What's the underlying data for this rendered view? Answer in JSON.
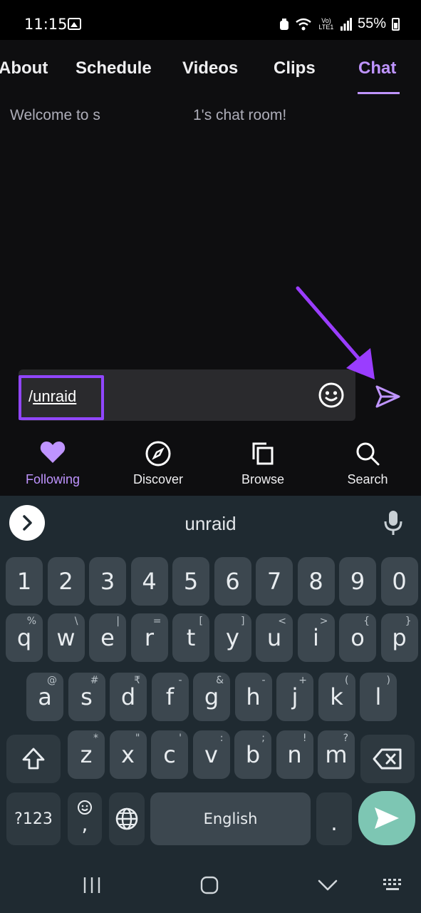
{
  "status_bar": {
    "time": "11:15",
    "network": "Vo) LTE1",
    "battery": "55%"
  },
  "tabs": {
    "items": [
      "About",
      "Schedule",
      "Videos",
      "Clips",
      "Chat"
    ],
    "active": "Chat"
  },
  "chat": {
    "welcome_left": "Welcome to s",
    "welcome_right": "1's chat room!"
  },
  "input": {
    "slash": "/",
    "value": "unraid"
  },
  "bottom_nav": {
    "following": "Following",
    "discover": "Discover",
    "browse": "Browse",
    "search": "Search"
  },
  "keyboard": {
    "suggestion": "unraid",
    "row_numbers": [
      "1",
      "2",
      "3",
      "4",
      "5",
      "6",
      "7",
      "8",
      "9",
      "0"
    ],
    "row_q": [
      "q",
      "w",
      "e",
      "r",
      "t",
      "y",
      "u",
      "i",
      "o",
      "p"
    ],
    "row_q_sup": [
      "%",
      "\\",
      "|",
      "=",
      "[",
      "]",
      "<",
      ">",
      "{",
      "}"
    ],
    "row_a": [
      "a",
      "s",
      "d",
      "f",
      "g",
      "h",
      "j",
      "k",
      "l"
    ],
    "row_a_sup": [
      "@",
      "#",
      "₹",
      "-",
      "&",
      "-",
      "+",
      "(",
      ")"
    ],
    "row_z": [
      "z",
      "x",
      "c",
      "v",
      "b",
      "n",
      "m"
    ],
    "row_z_sup": [
      "*",
      "\"",
      "'",
      ":",
      ";",
      "!",
      "?"
    ],
    "sym_key": "?123",
    "comma": ",",
    "space": "English",
    "period": "."
  },
  "colors": {
    "accent": "#bf94ff",
    "highlight": "#9146ff",
    "keyboard_bg": "#1f2a31",
    "key_bg": "#3c474f",
    "enter_key": "#7dc6b3"
  }
}
